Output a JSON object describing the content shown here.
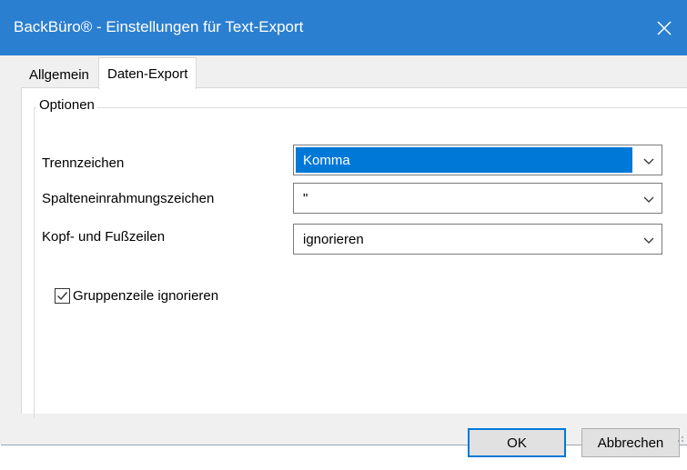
{
  "window": {
    "title": "BackBüro® - Einstellungen für Text-Export",
    "close_icon": "close-icon"
  },
  "tabs": [
    {
      "label": "Allgemein",
      "active": false
    },
    {
      "label": "Daten-Export",
      "active": true
    }
  ],
  "options": {
    "group_label": "Optionen",
    "fields": [
      {
        "label": "Trennzeichen",
        "value": "Komma",
        "selected": true
      },
      {
        "label": "Spalteneinrahmungszeichen",
        "value": "\"",
        "selected": false
      },
      {
        "label": "Kopf- und Fußzeilen",
        "value": "ignorieren",
        "selected": false
      }
    ],
    "checkbox": {
      "label": "Gruppenzeile ignorieren",
      "checked": true
    }
  },
  "buttons": {
    "ok": "OK",
    "cancel": "Abbrechen"
  },
  "colors": {
    "titlebar": "#2b7fd0",
    "selection": "#0078d7",
    "dialog_bg": "#f0f0f0"
  }
}
